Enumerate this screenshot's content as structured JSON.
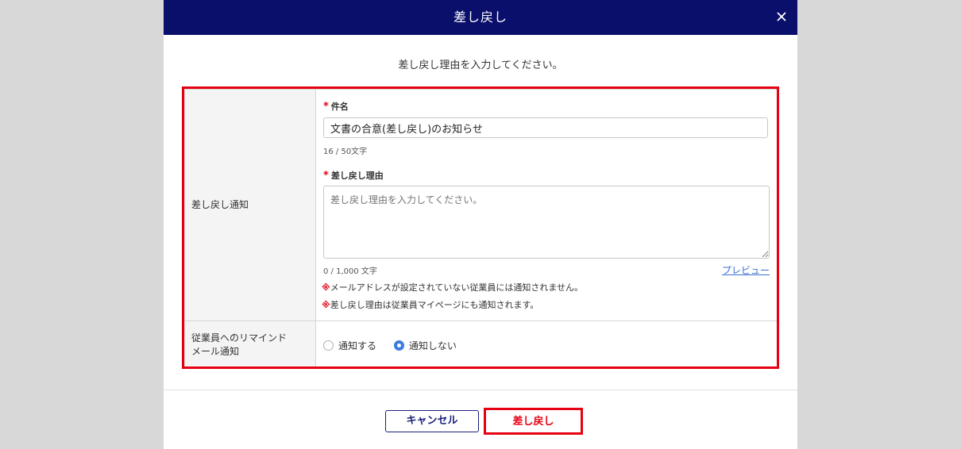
{
  "dialog": {
    "title": "差し戻し",
    "instruction": "差し戻し理由を入力してください。"
  },
  "form": {
    "notification_label": "差し戻し通知",
    "subject": {
      "label": "件名",
      "value": "文書の合意(差し戻し)のお知らせ",
      "counter": "16 / 50文字"
    },
    "reason": {
      "label": "差し戻し理由",
      "placeholder": "差し戻し理由を入力してください。",
      "counter": "0 / 1,000 文字",
      "preview_link": "プレビュー"
    },
    "required_mark": "*",
    "notes": [
      "メールアドレスが設定されていない従業員には通知されません。",
      "差し戻し理由は従業員マイページにも通知されます。"
    ],
    "note_mark": "※",
    "reminder": {
      "label_line1": "従業員へのリマインド",
      "label_line2": "メール通知",
      "options": [
        "通知する",
        "通知しない"
      ],
      "selected": "通知しない"
    }
  },
  "footer": {
    "cancel_label": "キャンセル",
    "submit_label": "差し戻し"
  },
  "colors": {
    "header_bg": "#0a0f6b",
    "highlight": "#e60012",
    "radio_selected": "#3d7be0",
    "link": "#3b6fd4"
  },
  "icons": {
    "close": "close-icon"
  }
}
